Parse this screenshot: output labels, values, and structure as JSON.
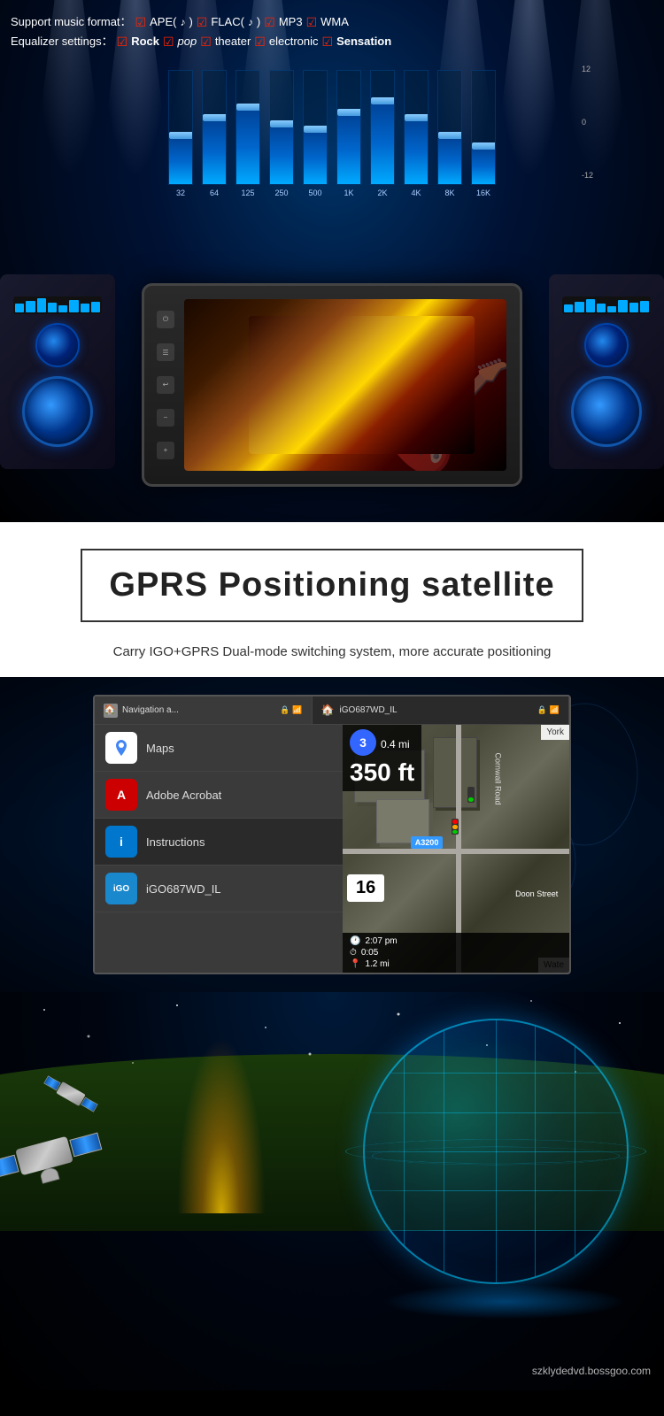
{
  "music_section": {
    "support_label": "Support music format：",
    "formats": [
      "APE(",
      "♪",
      ")",
      "FLAC(",
      "♪",
      ")",
      "MP3",
      "WMA"
    ],
    "equalizer_label": "Equalizer settings：",
    "eq_modes": [
      "Rock",
      "pop",
      "theater",
      "electronic",
      "Sensation"
    ],
    "eq_bands": [
      {
        "freq": "32",
        "height_pct": 40,
        "handle_pct": 60
      },
      {
        "freq": "64",
        "height_pct": 55,
        "handle_pct": 45
      },
      {
        "freq": "125",
        "height_pct": 65,
        "handle_pct": 35
      },
      {
        "freq": "250",
        "height_pct": 50,
        "handle_pct": 50
      },
      {
        "freq": "500",
        "height_pct": 45,
        "handle_pct": 55
      },
      {
        "freq": "1K",
        "height_pct": 60,
        "handle_pct": 40
      },
      {
        "freq": "2K",
        "height_pct": 70,
        "handle_pct": 30
      },
      {
        "freq": "4K",
        "height_pct": 55,
        "handle_pct": 45
      },
      {
        "freq": "8K",
        "height_pct": 40,
        "handle_pct": 60
      },
      {
        "freq": "16K",
        "height_pct": 30,
        "handle_pct": 70
      }
    ],
    "scale_top": "12",
    "scale_mid": "0",
    "scale_bot": "-12"
  },
  "gprs_section": {
    "title": "GPRS Positioning satellite",
    "subtitle": "Carry IGO+GPRS Dual-mode switching system, more accurate positioning"
  },
  "nav_section": {
    "tab1_label": "Navigation a...",
    "tab2_label": "iGO687WD_IL",
    "apps": [
      {
        "name": "Maps",
        "icon_type": "maps"
      },
      {
        "name": "Adobe Acrobat",
        "icon_type": "acrobat"
      },
      {
        "name": "Instructions",
        "icon_type": "info"
      },
      {
        "name": "iGO687WD_IL",
        "icon_type": "igo"
      }
    ],
    "map_info": {
      "step_num": "3",
      "distance_m": "0.4",
      "distance_unit": "mi",
      "distance_ft": "350 ft",
      "street_a3200": "A3200",
      "doon_street": "Doon Street",
      "cornwall_road": "Cornwall Road",
      "speed": "16",
      "time": "2:07 pm",
      "travel_time": "0:05",
      "distance_mi": "1.2 mi",
      "york_label": "York",
      "water_label": "Wate"
    }
  },
  "footer": {
    "website": "szklydedvd.bossgoo.com"
  }
}
